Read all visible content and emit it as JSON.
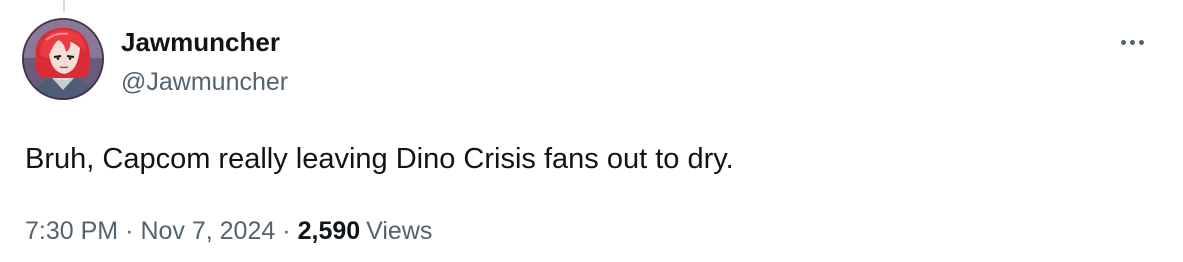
{
  "author": {
    "display_name": "Jawmuncher",
    "handle": "@Jawmuncher",
    "avatar_icon": "red-haired-character-avatar"
  },
  "menu": {
    "icon": "more-horizontal-icon"
  },
  "tweet": {
    "text": "Bruh, Capcom really leaving Dino Crisis fans out to dry.",
    "time": "7:30 PM",
    "separator1": "·",
    "date": "Nov 7, 2024",
    "separator2": "·",
    "views_count": "2,590",
    "views_label": "Views"
  },
  "colors": {
    "primary_text": "#0f1419",
    "secondary_text": "#536471",
    "thread_line": "#cfd9de",
    "avatar_hair": "#e2343d"
  }
}
